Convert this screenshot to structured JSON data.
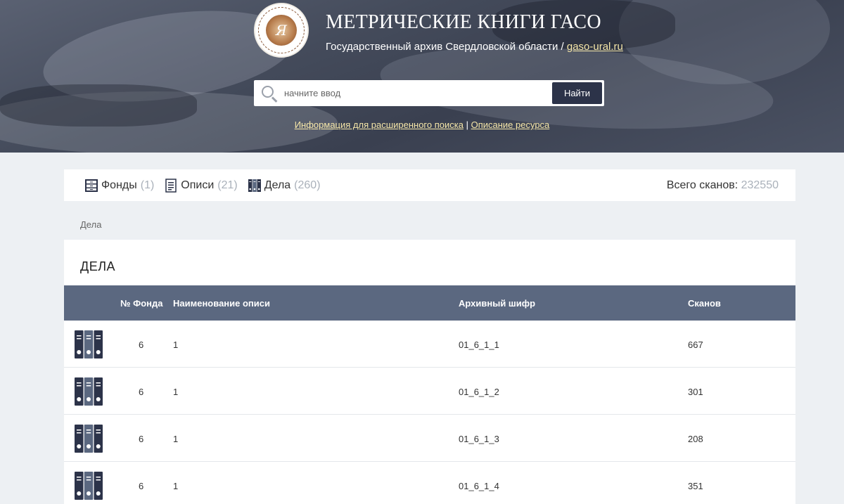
{
  "header": {
    "title": "МЕТРИЧЕСКИЕ КНИГИ ГАСО",
    "subtitle_text": "Государственный архив Свердловской области / ",
    "subtitle_link": "gaso-ural.ru",
    "logo_text": "Государственный архив Свердловской области",
    "logo_icon": "archive-seal-logo",
    "search_placeholder": "начните ввод",
    "search_button": "Найти",
    "link_advanced": "Информация для расширенного поиска",
    "link_separator": " | ",
    "link_about": "Описание ресурса"
  },
  "tabs": [
    {
      "label": "Фонды",
      "count": "(1)",
      "icon": "cabinet-icon"
    },
    {
      "label": "Описи",
      "count": "(21)",
      "icon": "document-icon"
    },
    {
      "label": "Дела",
      "count": "(260)",
      "icon": "binders-icon"
    }
  ],
  "scans": {
    "label": "Всего сканов: ",
    "value": "232550"
  },
  "breadcrumb": "Дела",
  "section_title": "ДЕЛА",
  "table": {
    "headers": [
      "№ Фонда",
      "Наименование описи",
      "Архивный шифр",
      "Сканов"
    ],
    "rows": [
      {
        "fond": "6",
        "opis": "1",
        "code": "01_6_1_1",
        "scans": "667"
      },
      {
        "fond": "6",
        "opis": "1",
        "code": "01_6_1_2",
        "scans": "301"
      },
      {
        "fond": "6",
        "opis": "1",
        "code": "01_6_1_3",
        "scans": "208"
      },
      {
        "fond": "6",
        "opis": "1",
        "code": "01_6_1_4",
        "scans": "351"
      }
    ]
  },
  "colors": {
    "accent": "#2c3349",
    "table_header": "#5b6880",
    "link": "#f5e6a8",
    "muted": "#aab1ba"
  }
}
